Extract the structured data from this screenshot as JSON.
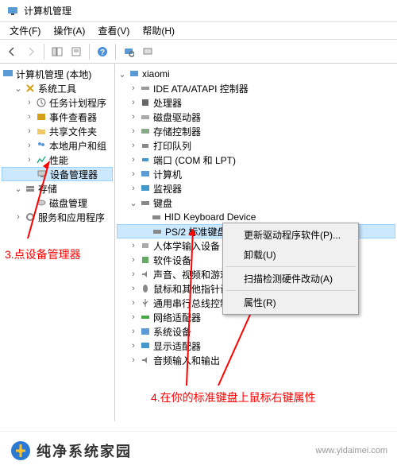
{
  "window": {
    "title": "计算机管理"
  },
  "menu": {
    "file": "文件(F)",
    "action": "操作(A)",
    "view": "查看(V)",
    "help": "帮助(H)"
  },
  "left_tree": {
    "root": "计算机管理 (本地)",
    "system_tools": "系统工具",
    "task_scheduler": "任务计划程序",
    "event_viewer": "事件查看器",
    "shared_folders": "共享文件夹",
    "local_users": "本地用户和组",
    "performance": "性能",
    "device_manager": "设备管理器",
    "storage": "存储",
    "disk_mgmt": "磁盘管理",
    "services_apps": "服务和应用程序"
  },
  "right_tree": {
    "root": "xiaomi",
    "ide": "IDE ATA/ATAPI 控制器",
    "cpu": "处理器",
    "disk_drive": "磁盘驱动器",
    "storage_ctrl": "存储控制器",
    "print_queue": "打印队列",
    "ports": "端口 (COM 和 LPT)",
    "computer": "计算机",
    "monitor": "监视器",
    "keyboard": "键盘",
    "hid_kb": "HID Keyboard Device",
    "ps2_kb": "PS/2 标准键盘",
    "hid": "人体学输入设备",
    "software": "软件设备",
    "sound": "声音、视频和游戏控制器",
    "mouse": "鼠标和其他指针设备",
    "usb": "通用串行总线控制器",
    "network": "网络适配器",
    "system_dev": "系统设备",
    "display": "显示适配器",
    "audio_io": "音频输入和输出"
  },
  "context_menu": {
    "update": "更新驱动程序软件(P)...",
    "uninstall": "卸载(U)",
    "scan": "扫描检测硬件改动(A)",
    "properties": "属性(R)"
  },
  "annotations": {
    "step3": "3.点设备管理器",
    "step4": "4.在你的标准键盘上鼠标右键属性"
  },
  "footer": {
    "brand": "纯净系统家园",
    "url": "www.yidaimei.com"
  }
}
